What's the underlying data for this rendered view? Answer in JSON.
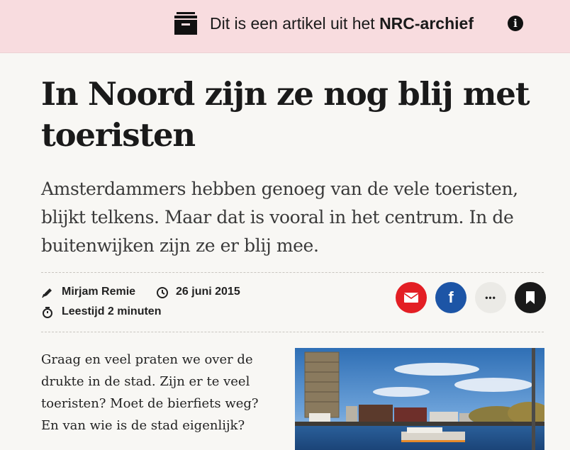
{
  "banner": {
    "icon": "archive-box-icon",
    "text_prefix": "Dit is een artikel uit het ",
    "text_brand": "NRC-archief",
    "info_icon_glyph": "i",
    "background": "#f8dcdf"
  },
  "article": {
    "title": "In Noord zijn ze nog blij met toeristen",
    "lead": "Amsterdammers hebben genoeg van de vele toeristen, blijkt telkens. Maar dat is vooral in het centrum. In de buitenwijken zijn ze er blij mee.",
    "author": "Mirjam Remie",
    "date": "26 juni 2015",
    "reading_time": "Leestijd 2 minuten",
    "body": "Graag en veel praten we over de drukte in de stad. Zijn er te veel toeristen? Moet de bierfiets weg? En van wie is de stad eigenlijk?"
  },
  "share": {
    "facebook_glyph": "f",
    "more_glyph": "•••",
    "mail_color": "#e31e24",
    "facebook_color": "#1d55a6",
    "bookmark_color": "#1a1a1a"
  }
}
